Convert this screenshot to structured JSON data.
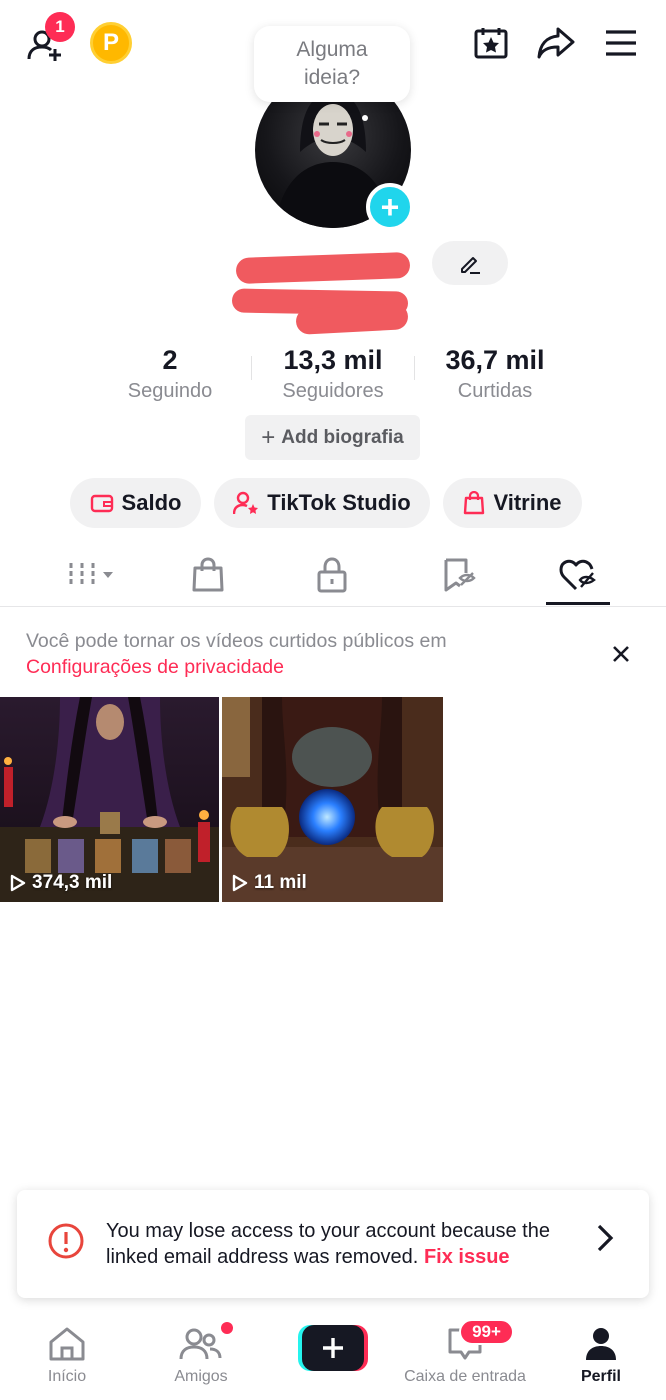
{
  "topbar": {
    "friend_badge": "1",
    "coin_letter": "P"
  },
  "avatar": {
    "bubble_line1": "Alguma",
    "bubble_line2": "ideia?",
    "add_symbol": "+"
  },
  "stats": [
    {
      "value": "2",
      "label": "Seguindo"
    },
    {
      "value": "13,3 mil",
      "label": "Seguidores"
    },
    {
      "value": "36,7 mil",
      "label": "Curtidas"
    }
  ],
  "bio_button": "Add biografia",
  "action_pills": [
    {
      "label": "Saldo",
      "icon": "wallet-icon"
    },
    {
      "label": "TikTok Studio",
      "icon": "creator-icon"
    },
    {
      "label": "Vitrine",
      "icon": "shopping-bag-icon"
    }
  ],
  "tabs": [
    {
      "name": "videos",
      "icon": "grid-icon"
    },
    {
      "name": "shop",
      "icon": "bag-icon"
    },
    {
      "name": "private",
      "icon": "lock-icon"
    },
    {
      "name": "favorites",
      "icon": "bookmark-icon"
    },
    {
      "name": "liked",
      "icon": "heart-icon",
      "active": true
    }
  ],
  "notice": {
    "text": "Você pode tornar os vídeos curtidos públicos em",
    "link": "Configurações de privacidade"
  },
  "videos": [
    {
      "views": "374,3 mil"
    },
    {
      "views": "11 mil"
    }
  ],
  "warning": {
    "text": "You may lose access to your account because the linked email address was removed.",
    "fix_label": "Fix issue"
  },
  "bottom_nav": {
    "home": "Início",
    "friends": "Amigos",
    "inbox": "Caixa de entrada",
    "inbox_badge": "99+",
    "profile": "Perfil"
  },
  "colors": {
    "accent": "#fe2c55",
    "cyan": "#20d5ec",
    "coin": "#ffb800"
  }
}
